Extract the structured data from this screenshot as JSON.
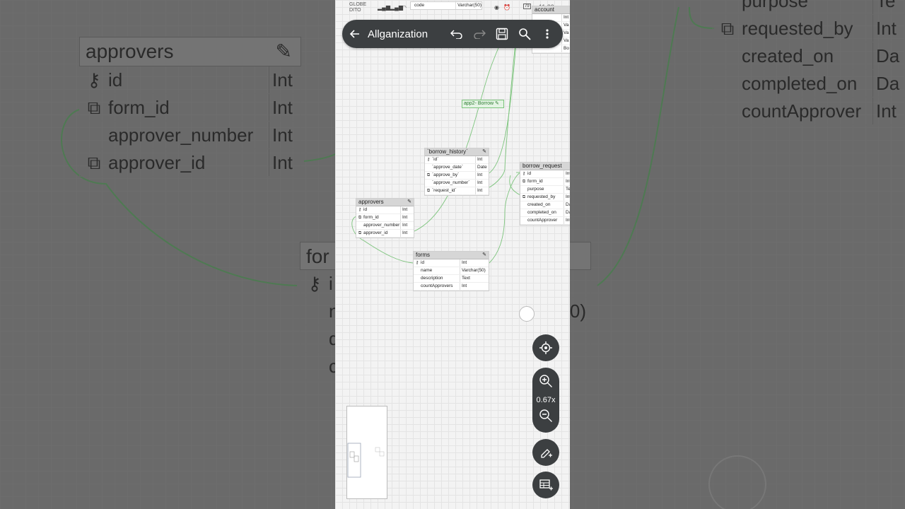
{
  "app": {
    "title": "Allganization"
  },
  "status_bar": {
    "carrier_top": "GLOBE",
    "carrier_bottom": "DITO",
    "time": "11:39",
    "battery": "79"
  },
  "toolbar": {
    "back_icon": "arrow-left-icon",
    "undo_icon": "undo-icon",
    "redo_icon": "redo-icon",
    "save_icon": "save-icon",
    "search_icon": "search-icon",
    "more_icon": "more-vert-icon"
  },
  "zoom": {
    "level": "0.67x"
  },
  "relationship_label": "app2- Borrow",
  "tables": {
    "account_top": {
      "col": "code",
      "type": "Varchar(50)"
    },
    "account": {
      "name": "account",
      "types": [
        "Int",
        "Va",
        "Va",
        "Va",
        "Bo"
      ]
    },
    "borrow_history": {
      "name": "`borrow_history`",
      "rows": [
        {
          "key": "pk",
          "name": "`id`",
          "type": "Int"
        },
        {
          "key": "",
          "name": "`approve_date`",
          "type": "Date"
        },
        {
          "key": "fk",
          "name": "`approve_by`",
          "type": "Int"
        },
        {
          "key": "",
          "name": "`approve_number`",
          "type": "Int"
        },
        {
          "key": "fk",
          "name": "`request_id`",
          "type": "Int"
        }
      ]
    },
    "borrow_request": {
      "name": "borrow_request",
      "rows": [
        {
          "key": "pk",
          "name": "id",
          "type": "Int"
        },
        {
          "key": "fk",
          "name": "form_id",
          "type": "Int"
        },
        {
          "key": "",
          "name": "purpose",
          "type": "Te"
        },
        {
          "key": "fk",
          "name": "requested_by",
          "type": "Int"
        },
        {
          "key": "",
          "name": "created_on",
          "type": "Da"
        },
        {
          "key": "",
          "name": "completed_on",
          "type": "Da"
        },
        {
          "key": "",
          "name": "countApprover",
          "type": "Int"
        }
      ]
    },
    "approvers": {
      "name": "approvers",
      "rows": [
        {
          "key": "pk",
          "name": "id",
          "type": "Int"
        },
        {
          "key": "fk",
          "name": "form_id",
          "type": "Int"
        },
        {
          "key": "",
          "name": "approver_number",
          "type": "Int"
        },
        {
          "key": "fk",
          "name": "approver_id",
          "type": "Int"
        }
      ]
    },
    "forms": {
      "name": "forms",
      "rows": [
        {
          "key": "pk",
          "name": "id",
          "type": "Int"
        },
        {
          "key": "",
          "name": "name",
          "type": "Varchar(50)"
        },
        {
          "key": "",
          "name": "description",
          "type": "Text"
        },
        {
          "key": "",
          "name": "countApprovers",
          "type": "Int"
        }
      ]
    }
  },
  "background": {
    "approvers": {
      "name": "approvers",
      "rows": [
        {
          "name": "id",
          "type": "Int"
        },
        {
          "name": "form_id",
          "type": "Int"
        },
        {
          "name": "approver_number",
          "type": "Int"
        },
        {
          "name": "approver_id",
          "type": "Int"
        }
      ]
    },
    "right_rows": [
      {
        "name": "purpose",
        "type": "Te"
      },
      {
        "name": "requested_by",
        "type": "Int"
      },
      {
        "name": "created_on",
        "type": "Da"
      },
      {
        "name": "completed_on",
        "type": "Da"
      },
      {
        "name": "countApprover",
        "type": "Int"
      }
    ],
    "forms_header": "for",
    "forms_row_i": "i",
    "forms_row_n": "n",
    "forms_row_d": "d",
    "forms_row_c": "c",
    "forms_tail": "0)"
  }
}
